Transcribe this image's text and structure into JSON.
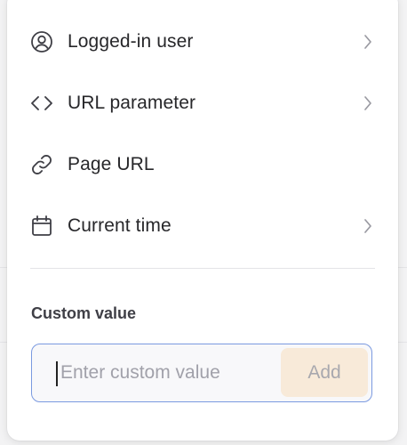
{
  "menu": {
    "items": [
      {
        "label": "Logged-in user",
        "icon": "user-circle-icon",
        "has_submenu": true
      },
      {
        "label": "URL parameter",
        "icon": "code-brackets-icon",
        "has_submenu": true
      },
      {
        "label": "Page URL",
        "icon": "link-icon",
        "has_submenu": false
      },
      {
        "label": "Current time",
        "icon": "calendar-icon",
        "has_submenu": true
      }
    ]
  },
  "custom": {
    "section_label": "Custom value",
    "input_value": "",
    "placeholder": "Enter custom value",
    "add_label": "Add"
  },
  "colors": {
    "input_focus_border": "#7b9ae0",
    "add_button_bg": "#f8ead9",
    "add_button_text": "#a8a8ae"
  }
}
